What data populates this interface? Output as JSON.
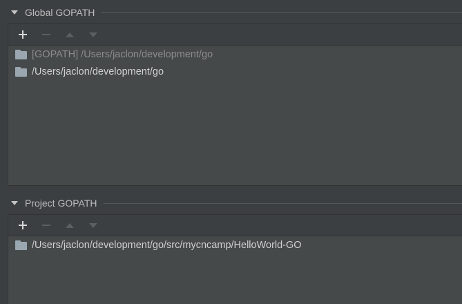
{
  "global_section": {
    "title": "Global GOPATH",
    "toolbar": {
      "add_icon": "plus-icon",
      "remove_icon": "minus-icon",
      "move_up_icon": "arrow-up-icon",
      "move_down_icon": "arrow-down-icon"
    },
    "items": [
      {
        "label": "[GOPATH] /Users/jaclon/development/go",
        "icon": "folder-icon",
        "muted": true
      },
      {
        "label": "/Users/jaclon/development/go",
        "icon": "folder-icon",
        "muted": false
      }
    ]
  },
  "project_section": {
    "title": "Project GOPATH",
    "toolbar": {
      "add_icon": "plus-icon",
      "remove_icon": "minus-icon",
      "move_up_icon": "arrow-up-icon",
      "move_down_icon": "arrow-down-icon"
    },
    "items": [
      {
        "label": "/Users/jaclon/development/go/src/mycncamp/HelloWorld-GO",
        "icon": "folder-icon",
        "muted": false
      }
    ]
  },
  "colors": {
    "background": "#3c3f41",
    "panel": "#45494a",
    "text": "#bbbbbb",
    "muted_text": "#8c8c8c",
    "folder": "#9aa7b0"
  }
}
